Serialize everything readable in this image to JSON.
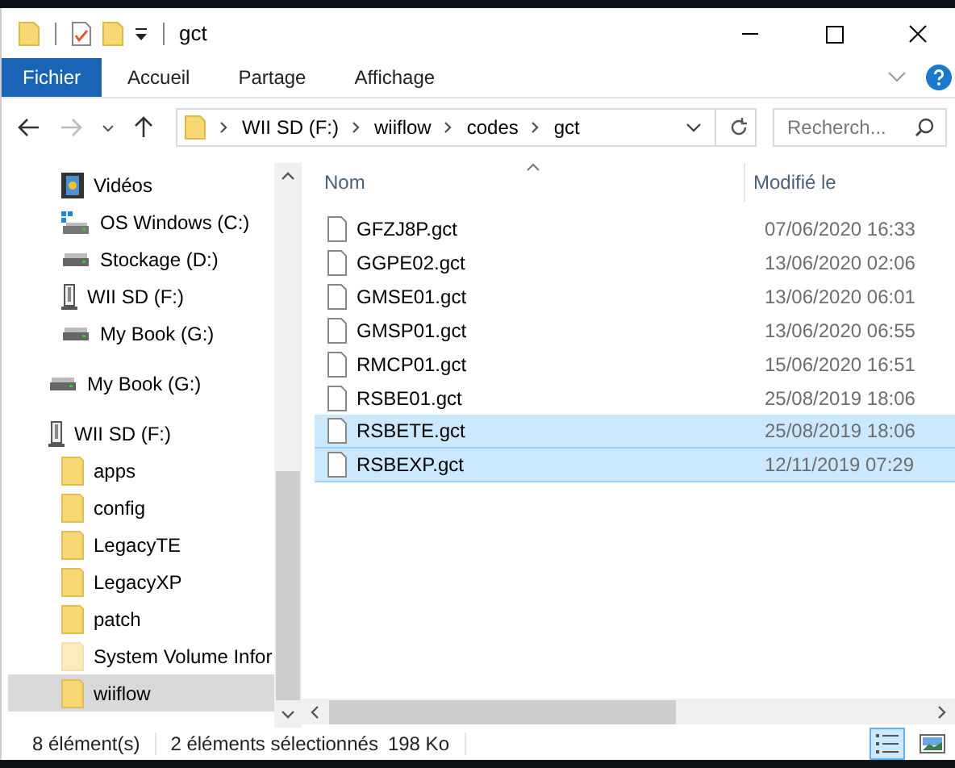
{
  "window": {
    "title": "gct"
  },
  "ribbon_tabs": [
    {
      "label": "Fichier",
      "selected": true
    },
    {
      "label": "Accueil",
      "selected": false
    },
    {
      "label": "Partage",
      "selected": false
    },
    {
      "label": "Affichage",
      "selected": false
    }
  ],
  "address": {
    "crumbs": [
      "WII SD (F:)",
      "wiiflow",
      "codes",
      "gct"
    ]
  },
  "search": {
    "placeholder": "Recherch..."
  },
  "sidebar": {
    "upper_items": [
      {
        "label": "Vidéos",
        "kind": "video"
      },
      {
        "label": "OS Windows (C:)",
        "kind": "osdrive"
      },
      {
        "label": "Stockage (D:)",
        "kind": "drive"
      },
      {
        "label": "WII SD (F:)",
        "kind": "sd"
      },
      {
        "label": "My Book (G:)",
        "kind": "drive"
      }
    ],
    "items": [
      {
        "label": "My Book (G:)",
        "kind": "drive",
        "selected": false
      },
      {
        "label": "WII SD (F:)",
        "kind": "sd",
        "selected": false,
        "children": [
          {
            "label": "apps",
            "kind": "folder",
            "selected": false,
            "hidden": false
          },
          {
            "label": "config",
            "kind": "folder",
            "selected": false,
            "hidden": false
          },
          {
            "label": "LegacyTE",
            "kind": "folder",
            "selected": false,
            "hidden": false
          },
          {
            "label": "LegacyXP",
            "kind": "folder",
            "selected": false,
            "hidden": false
          },
          {
            "label": "patch",
            "kind": "folder",
            "selected": false,
            "hidden": false
          },
          {
            "label": "System Volume Infor",
            "kind": "folder",
            "selected": false,
            "hidden": true
          },
          {
            "label": "wiiflow",
            "kind": "folder",
            "selected": true,
            "hidden": false
          }
        ]
      }
    ]
  },
  "table": {
    "columns": [
      "Nom",
      "Modifié le"
    ],
    "rows": [
      {
        "name": "GFZJ8P.gct",
        "modified": "07/06/2020 16:33",
        "selected": false
      },
      {
        "name": "GGPE02.gct",
        "modified": "13/06/2020 02:06",
        "selected": false
      },
      {
        "name": "GMSE01.gct",
        "modified": "13/06/2020 06:01",
        "selected": false
      },
      {
        "name": "GMSP01.gct",
        "modified": "13/06/2020 06:55",
        "selected": false
      },
      {
        "name": "RMCP01.gct",
        "modified": "15/06/2020 16:51",
        "selected": false
      },
      {
        "name": "RSBE01.gct",
        "modified": "25/08/2019 18:06",
        "selected": false
      },
      {
        "name": "RSBETE.gct",
        "modified": "25/08/2019 18:06",
        "selected": true
      },
      {
        "name": "RSBEXP.gct",
        "modified": "12/11/2019 07:29",
        "selected": true
      }
    ]
  },
  "status_bar": {
    "count": "8 élément(s)",
    "selection": "2 éléments sélectionnés",
    "size": "198 Ko",
    "views": [
      {
        "kind": "details",
        "selected": true
      },
      {
        "kind": "thumbnails",
        "selected": false
      }
    ]
  }
}
